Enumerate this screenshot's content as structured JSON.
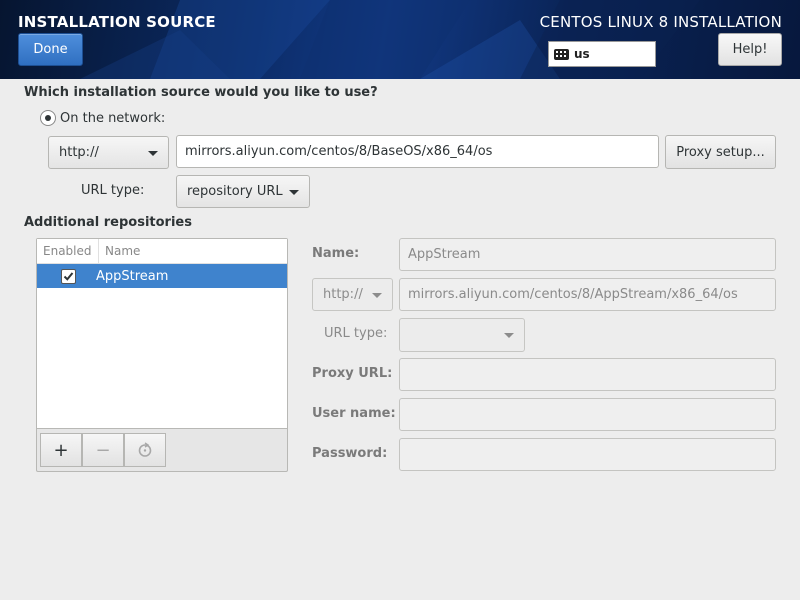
{
  "header": {
    "title": "INSTALLATION SOURCE",
    "product": "CENTOS LINUX 8 INSTALLATION",
    "done_label": "Done",
    "keyboard_layout": "us",
    "help_label": "Help!"
  },
  "source": {
    "question": "Which installation source would you like to use?",
    "network_option": "On the network:",
    "protocol": "http://",
    "url": "mirrors.aliyun.com/centos/8/BaseOS/x86_64/os",
    "proxy_label": "Proxy setup...",
    "url_type_label": "URL type:",
    "url_type_value": "repository URL"
  },
  "additional": {
    "title": "Additional repositories",
    "columns": [
      "Enabled",
      "Name"
    ],
    "repos": [
      {
        "enabled": true,
        "name": "AppStream"
      }
    ],
    "add_icon": "+",
    "remove_icon": "−"
  },
  "details": {
    "name_label": "Name:",
    "name_value": "AppStream",
    "protocol": "http://",
    "url": "mirrors.aliyun.com/centos/8/AppStream/x86_64/os",
    "url_type_label": "URL type:",
    "url_type_value": "",
    "proxy_url_label": "Proxy URL:",
    "proxy_url_value": "",
    "user_name_label": "User name:",
    "user_name_value": "",
    "password_label": "Password:",
    "password_value": ""
  },
  "colors": {
    "selection": "#3f83cd",
    "done_button": "#3a7bd0",
    "header_bg": "#0b2a63"
  }
}
